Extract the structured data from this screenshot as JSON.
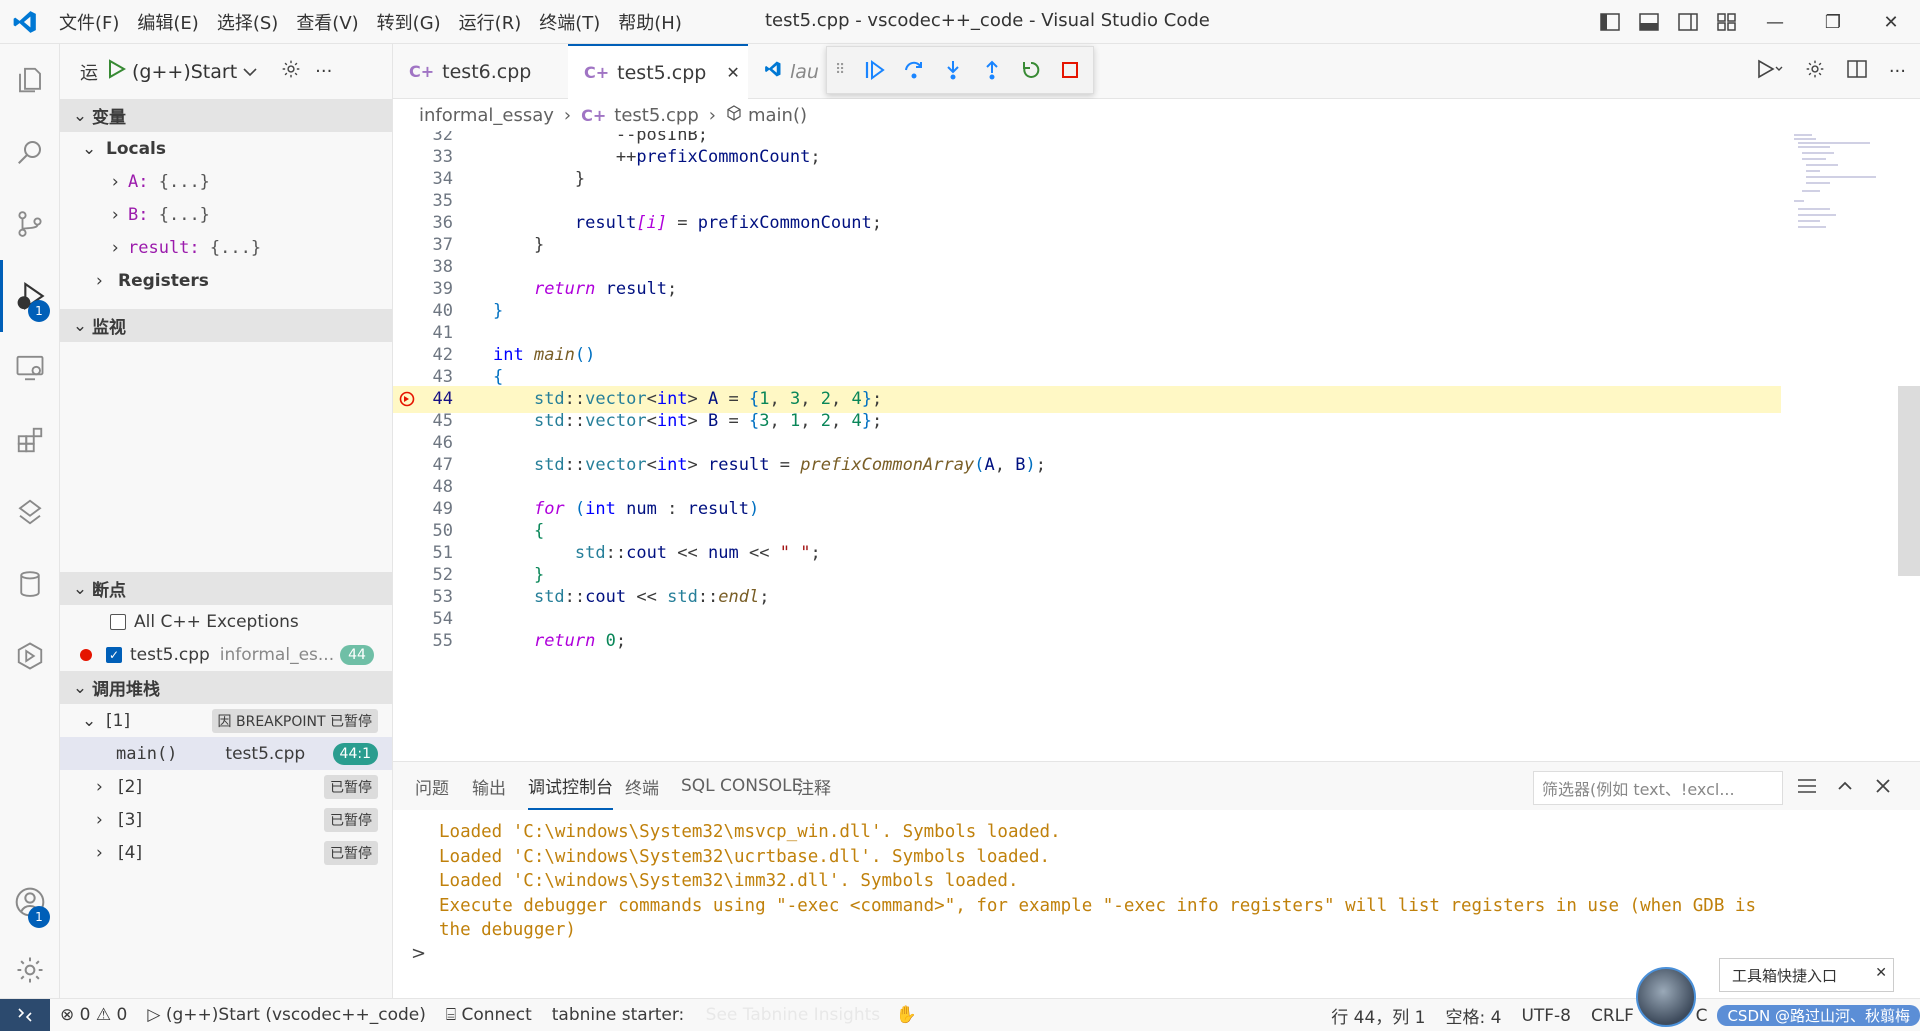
{
  "titlebar": {
    "menu": [
      "文件(F)",
      "编辑(E)",
      "选择(S)",
      "查看(V)",
      "转到(G)",
      "运行(R)",
      "终端(T)",
      "帮助(H)"
    ],
    "title": "test5.cpp - vscodec++_code - Visual Studio Code",
    "window_buttons": [
      "—",
      "❐",
      "✕"
    ]
  },
  "activity": {
    "debug_badge": "1",
    "account_badge": "1"
  },
  "run_toolbar": {
    "label": "运",
    "config": "(g++)Start"
  },
  "variables": {
    "title": "变量",
    "locals_label": "Locals",
    "items": [
      {
        "name": "A:",
        "value": "{...}"
      },
      {
        "name": "B:",
        "value": "{...}"
      },
      {
        "name": "result:",
        "value": "{...}"
      }
    ],
    "registers_label": "Registers"
  },
  "watch": {
    "title": "监视"
  },
  "breakpoints": {
    "title": "断点",
    "items": [
      {
        "label": "All C++ Exceptions",
        "checked": false
      },
      {
        "label": "test5.cpp",
        "path": "informal_es...",
        "line": "44",
        "checked": true
      }
    ]
  },
  "callstack": {
    "title": "调用堆栈",
    "threads": [
      {
        "label": "[1]",
        "status": "因 BREAKPOINT 已暂停"
      },
      {
        "label": "[2]",
        "status": "已暂停"
      },
      {
        "label": "[3]",
        "status": "已暂停"
      },
      {
        "label": "[4]",
        "status": "已暂停"
      }
    ],
    "frame": {
      "fn": "main()",
      "file": "test5.cpp",
      "pos": "44:1"
    }
  },
  "tabs": [
    {
      "label": "test6.cpp"
    },
    {
      "label": "test5.cpp",
      "close": "✕"
    },
    {
      "label": "lau"
    }
  ],
  "breadcrumb": {
    "folder": "informal_essay",
    "file": "test5.cpp",
    "symbol": "main()"
  },
  "editor": {
    "current_line": 44,
    "lines": [
      {
        "n": "32",
        "html": "            <span class='op'>--posInB;</span>"
      },
      {
        "n": "33",
        "html": "            <span class='op'>++</span><span class='id'>prefixCommonCount</span><span class='op'>;</span>"
      },
      {
        "n": "34",
        "html": "        <span class='op'>}</span>"
      },
      {
        "n": "35",
        "html": ""
      },
      {
        "n": "36",
        "html": "        <span class='id'>result</span><span class='kw'>[i]</span> <span class='op'>=</span> <span class='id'>prefixCommonCount</span><span class='op'>;</span>"
      },
      {
        "n": "37",
        "html": "    <span class='op'>}</span>"
      },
      {
        "n": "38",
        "html": ""
      },
      {
        "n": "39",
        "html": "    <span class='kw'>return</span> <span class='id'>result</span><span class='op'>;</span>"
      },
      {
        "n": "40",
        "html": "<span class='sym'>}</span>"
      },
      {
        "n": "41",
        "html": ""
      },
      {
        "n": "42",
        "html": "<span class='k'>int</span> <span class='fn'>main</span><span class='sym'>()</span>"
      },
      {
        "n": "43",
        "html": "<span class='sym'>{</span>"
      },
      {
        "n": "44",
        "html": "    <span class='ns'>std</span><span class='op'>::</span><span class='ty'>vector</span><span class='op'>&lt;</span><span class='k'>int</span><span class='op'>&gt;</span> <span class='id'>A</span> <span class='op'>=</span> <span class='sym'>{</span><span class='nm'>1</span>, <span class='nm'>3</span>, <span class='nm'>2</span>, <span class='nm'>4</span><span class='sym'>}</span>;"
      },
      {
        "n": "45",
        "html": "    <span class='ns'>std</span><span class='op'>::</span><span class='ty'>vector</span><span class='op'>&lt;</span><span class='k'>int</span><span class='op'>&gt;</span> <span class='id'>B</span> <span class='op'>=</span> <span class='sym'>{</span><span class='nm'>3</span>, <span class='nm'>1</span>, <span class='nm'>2</span>, <span class='nm'>4</span><span class='sym'>}</span>;"
      },
      {
        "n": "46",
        "html": ""
      },
      {
        "n": "47",
        "html": "    <span class='ns'>std</span><span class='op'>::</span><span class='ty'>vector</span><span class='op'>&lt;</span><span class='k'>int</span><span class='op'>&gt;</span> <span class='id'>result</span> <span class='op'>=</span> <span class='fn'>prefixCommonArray</span><span class='sym'>(</span><span class='id'>A</span>, <span class='id'>B</span><span class='sym'>)</span>;"
      },
      {
        "n": "48",
        "html": ""
      },
      {
        "n": "49",
        "html": "    <span class='kw'>for</span> <span class='sym'>(</span><span class='k'>int</span> <span class='id'>num</span> : <span class='id'>result</span><span class='sym'>)</span>"
      },
      {
        "n": "50",
        "html": "    <span class='nm'>{</span>"
      },
      {
        "n": "51",
        "html": "        <span class='ns'>std</span><span class='op'>::</span><span class='id'>cout</span> <span class='op'>&lt;&lt;</span> <span class='id'>num</span> <span class='op'>&lt;&lt;</span> <span class='st'>\" \"</span>;"
      },
      {
        "n": "52",
        "html": "    <span class='nm'>}</span>"
      },
      {
        "n": "53",
        "html": "    <span class='ns'>std</span><span class='op'>::</span><span class='id'>cout</span> <span class='op'>&lt;&lt;</span> <span class='ns'>std</span><span class='op'>::</span><span class='fn'>endl</span>;"
      },
      {
        "n": "54",
        "html": ""
      },
      {
        "n": "55",
        "html": "    <span class='kw'>return</span> <span class='nm'>0</span>;"
      }
    ]
  },
  "panel": {
    "tabs": [
      "问题",
      "输出",
      "调试控制台",
      "终端",
      "SQL CONSOLE",
      "注释"
    ],
    "active_tab": "调试控制台",
    "filter_placeholder": "筛选器(例如 text、!excl...",
    "output": [
      "Loaded 'C:\\windows\\System32\\msvcp_win.dll'. Symbols loaded.",
      "Loaded 'C:\\windows\\System32\\ucrtbase.dll'. Symbols loaded.",
      "Loaded 'C:\\windows\\System32\\imm32.dll'. Symbols loaded.",
      "Execute debugger commands using \"-exec <command>\", for example \"-exec info registers\" will list registers in use (when GDB is",
      "the debugger)"
    ],
    "prompt": ">",
    "tooltip": "工具箱快捷入口"
  },
  "statusbar": {
    "errors": "0",
    "warnings": "0",
    "debug": "(g++)Start (vscodec++_code)",
    "connect": "Connect",
    "tabnine": "tabnine starter:",
    "tabnine_hint": "See Tabnine Insights",
    "position": "行 44，列 1",
    "spaces": "空格: 4",
    "encoding": "UTF-8",
    "eol": "CRLF",
    "lang": "{}",
    "c_label": "C",
    "csdn": "CSDN @路过山河、秋翦梅"
  },
  "colors": {
    "accent": "#005fb8",
    "current_line": "#fff8c5",
    "breakpoint": "#e51400",
    "output": "#c0810c"
  }
}
